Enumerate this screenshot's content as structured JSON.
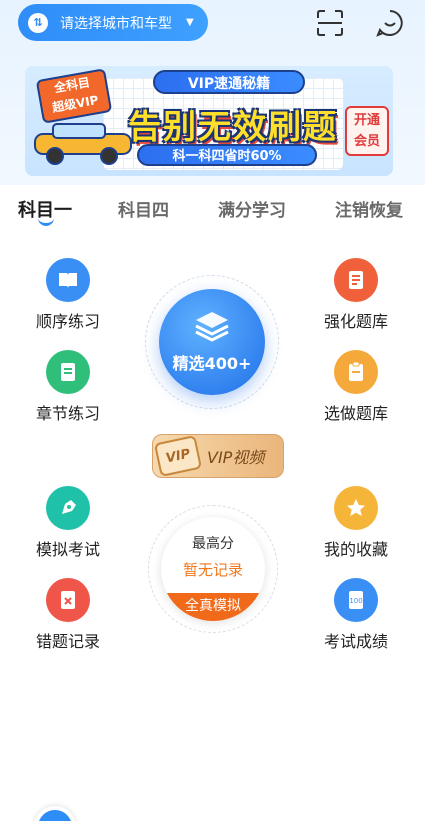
{
  "header": {
    "city_select_label": "请选择城市和车型",
    "city_icon_glyph": "⇅",
    "caret_glyph": "▼",
    "icons": [
      "refresh-icon",
      "scan-icon",
      "chat-icon"
    ]
  },
  "banner": {
    "badge_text": "全科目\n超级VIP",
    "vip_title": "VIP速通秘籍",
    "headline": "告别无效刷题",
    "subline": "科一科四省时60%",
    "open_vip": "开通\n会员"
  },
  "tabs": [
    {
      "label": "科目一",
      "active": true
    },
    {
      "label": "科目四",
      "active": false
    },
    {
      "label": "满分学习",
      "active": false
    },
    {
      "label": "注销恢复",
      "active": false
    }
  ],
  "functions": {
    "sequential": "顺序练习",
    "chapter": "章节练习",
    "mock_exam": "模拟考试",
    "wrong_record": "错题记录",
    "intensive_bank": "强化题库",
    "custom_bank": "选做题库",
    "favorites": "我的收藏",
    "scores": "考试成绩"
  },
  "center": {
    "selected_label": "精选400+",
    "vip_mark": "VIP",
    "vip_video": "VIP视频",
    "score_title": "最高分",
    "score_value": "暂无记录",
    "full_mock": "全真模拟"
  },
  "colors": {
    "primary_blue": "#2e8df6",
    "orange": "#f06a1a",
    "green": "#2fbf7a",
    "red": "#f0554a",
    "yellow": "#f5b538"
  }
}
